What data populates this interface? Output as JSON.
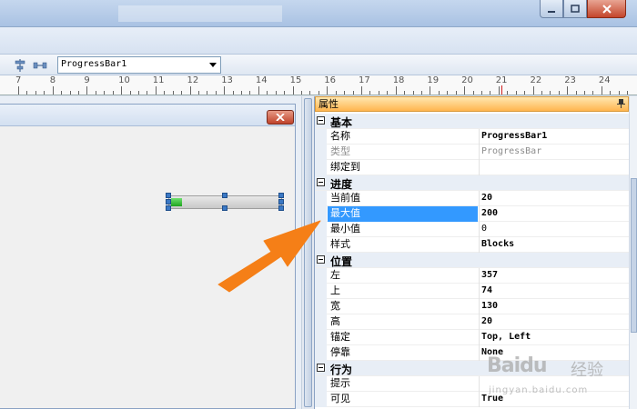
{
  "window": {
    "title": ""
  },
  "toolbar": {
    "component_select": "ProgressBar1"
  },
  "ruler": {
    "labels": [
      "7",
      "8",
      "9",
      "10",
      "11",
      "12",
      "13",
      "14",
      "15",
      "16",
      "17",
      "18",
      "19",
      "20",
      "21",
      "22",
      "23",
      "24"
    ]
  },
  "properties": {
    "header": "属性",
    "categories": [
      {
        "label": "基本",
        "rows": [
          {
            "name": "名称",
            "value": "ProgressBar1"
          },
          {
            "name": "类型",
            "value": "ProgressBar"
          },
          {
            "name": "绑定到",
            "value": ""
          }
        ]
      },
      {
        "label": "进度",
        "rows": [
          {
            "name": "当前值",
            "value": "20"
          },
          {
            "name": "最大值",
            "value": "200"
          },
          {
            "name": "最小值",
            "value": "0"
          },
          {
            "name": "样式",
            "value": "Blocks"
          }
        ]
      },
      {
        "label": "位置",
        "rows": [
          {
            "name": "左",
            "value": "357"
          },
          {
            "name": "上",
            "value": "74"
          },
          {
            "name": "宽",
            "value": "130"
          },
          {
            "name": "高",
            "value": "20"
          },
          {
            "name": "锚定",
            "value": "Top, Left"
          },
          {
            "name": "停靠",
            "value": "None"
          }
        ]
      },
      {
        "label": "行为",
        "rows": [
          {
            "name": "提示",
            "value": ""
          },
          {
            "name": "可见",
            "value": "True"
          }
        ]
      }
    ]
  },
  "progress_bar": {
    "value": 20,
    "min": 0,
    "max": 200
  },
  "watermark": {
    "brand": "Baidu",
    "cn": "经验",
    "url": "jingyan.baidu.com"
  },
  "colors": {
    "accent_orange": "#f57f17",
    "selection": "#3399ff"
  }
}
